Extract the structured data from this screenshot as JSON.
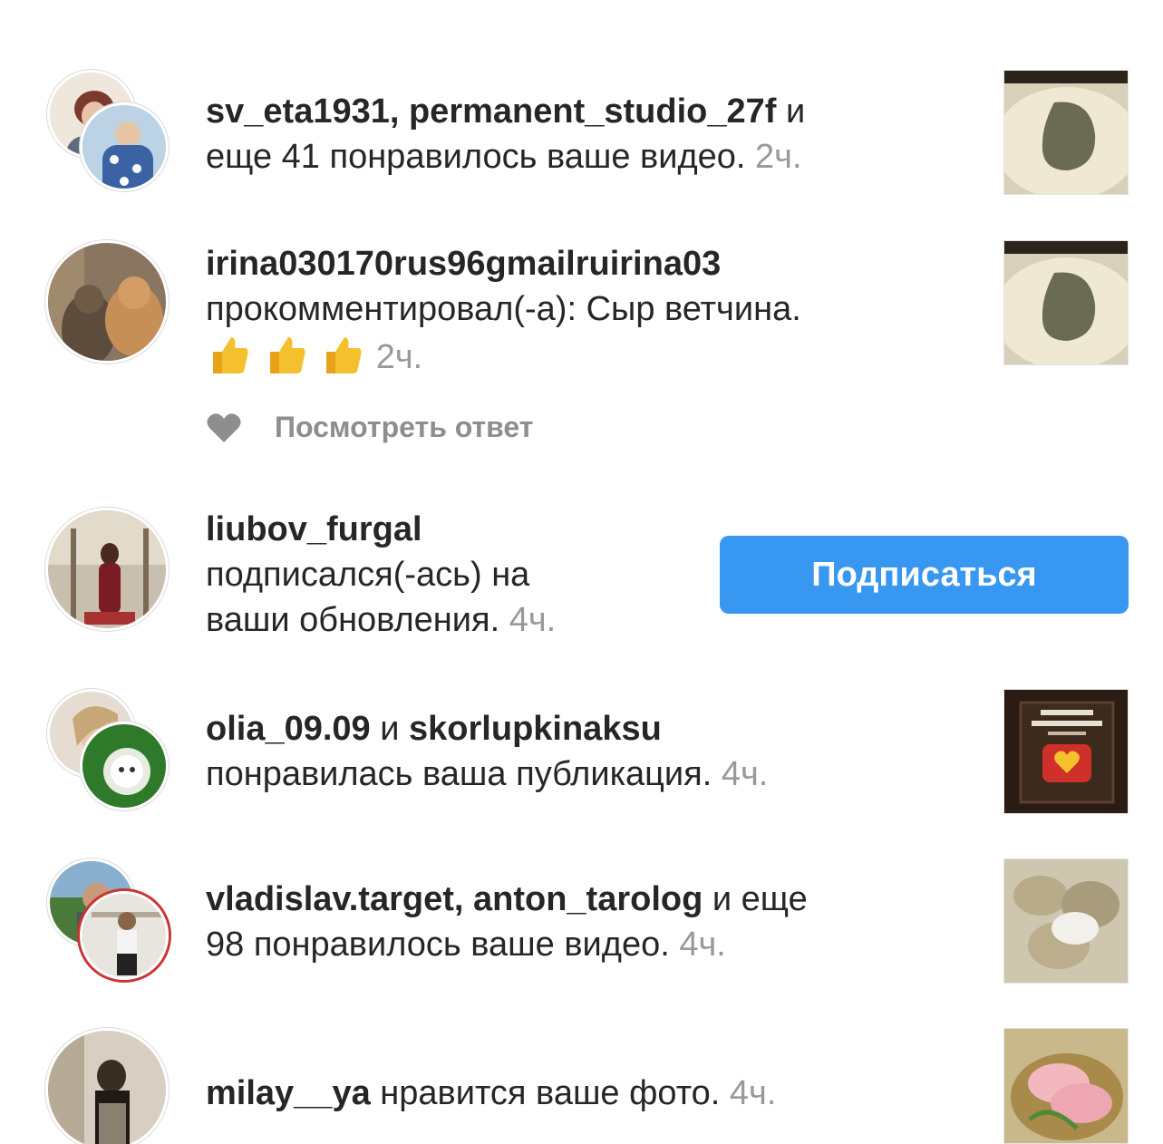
{
  "header": {
    "title": ""
  },
  "notifications": [
    {
      "user": "sv_eta1931, permanent_studio_27f",
      "line1_tail": " и",
      "line2": "еще 41 понравилось ваше видео.",
      "time": "2ч."
    },
    {
      "user": "irina030170rus96gmailruirina03",
      "line2": "прокомментировал(-а): Сыр ветчина.",
      "emoji_count": 3,
      "time": "2ч.",
      "reply_label": "Посмотреть ответ"
    },
    {
      "user": "liubov_furgal",
      "line2": "подписался(-ась) на",
      "line3": "ваши обновления.",
      "time": "4ч.",
      "follow_label": "Подписаться"
    },
    {
      "user": "olia_09.09",
      "conj": " и ",
      "user2": "skorlupkinaksu",
      "line2": "понравилась ваша публикация.",
      "time": "4ч."
    },
    {
      "user": "vladislav.target, anton_tarolog",
      "line1_tail": " и еще",
      "line2": "98 понравилось ваше видео.",
      "time": "4ч."
    },
    {
      "user": "milay__ya",
      "line1_tail": " нравится ваше фото.",
      "time": "4ч."
    }
  ],
  "colors": {
    "accent": "#3897f0",
    "text": "#262626",
    "muted": "#999999"
  }
}
